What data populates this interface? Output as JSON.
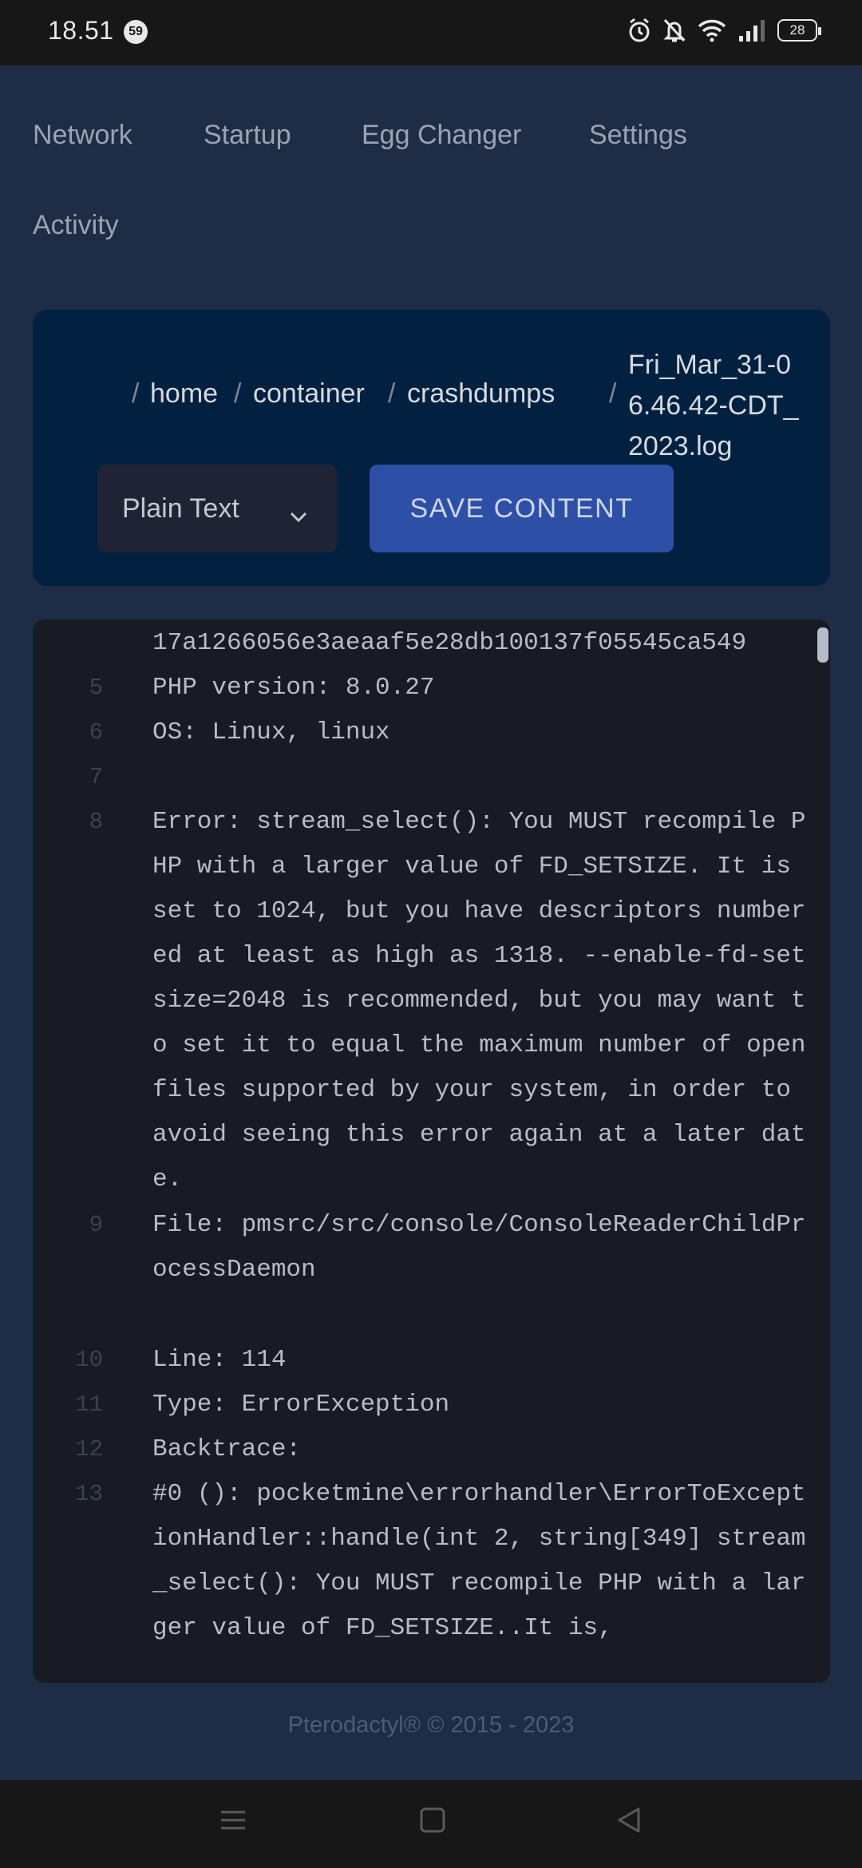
{
  "status_bar": {
    "time": "18.51",
    "notification_count": "59",
    "battery": "28",
    "icons": [
      "alarm-icon",
      "mute-icon",
      "wifi-icon",
      "signal-icon",
      "battery-icon"
    ]
  },
  "nav": {
    "tabs": [
      "Network",
      "Startup",
      "Egg Changer",
      "Settings",
      "Activity"
    ]
  },
  "file": {
    "breadcrumb": [
      "home",
      "container",
      "crashdumps"
    ],
    "separator": "/",
    "filename": "Fri_Mar_31-06.46.42-CDT_2023.log",
    "syntax_selected": "Plain Text",
    "save_label": "SAVE CONTENT"
  },
  "editor": {
    "lines": [
      {
        "num": "",
        "text": "17a1266056e3aeaaf5e28db100137f05545ca549"
      },
      {
        "num": "5",
        "text": "PHP version: 8.0.27"
      },
      {
        "num": "6",
        "text": "OS: Linux, linux"
      },
      {
        "num": "7",
        "text": ""
      },
      {
        "num": "8",
        "text": "Error: stream_select(): You MUST recompile PHP with a larger value of FD_SETSIZE. It is set to 1024, but you have descriptors numbered at least as high as 1318. --enable-fd-setsize=2048 is recommended, but you may want to set it to equal the maximum number of open files supported by your system, in order to avoid seeing this error again at a later date."
      },
      {
        "num": "9",
        "text": "File: pmsrc/src/console/ConsoleReaderChildProcessDaemon"
      },
      {
        "num": "10",
        "text": "Line: 114"
      },
      {
        "num": "11",
        "text": "Type: ErrorException"
      },
      {
        "num": "12",
        "text": "Backtrace:"
      },
      {
        "num": "13",
        "text": "#0 (): pocketmine\\errorhandler\\ErrorToExceptionHandler::handle(int 2, string[349] stream_select(): You MUST recompile PHP with a larger value of FD_SETSIZE..It is,"
      }
    ]
  },
  "footer": {
    "text": "Pterodactyl® © 2015 - 2023"
  }
}
